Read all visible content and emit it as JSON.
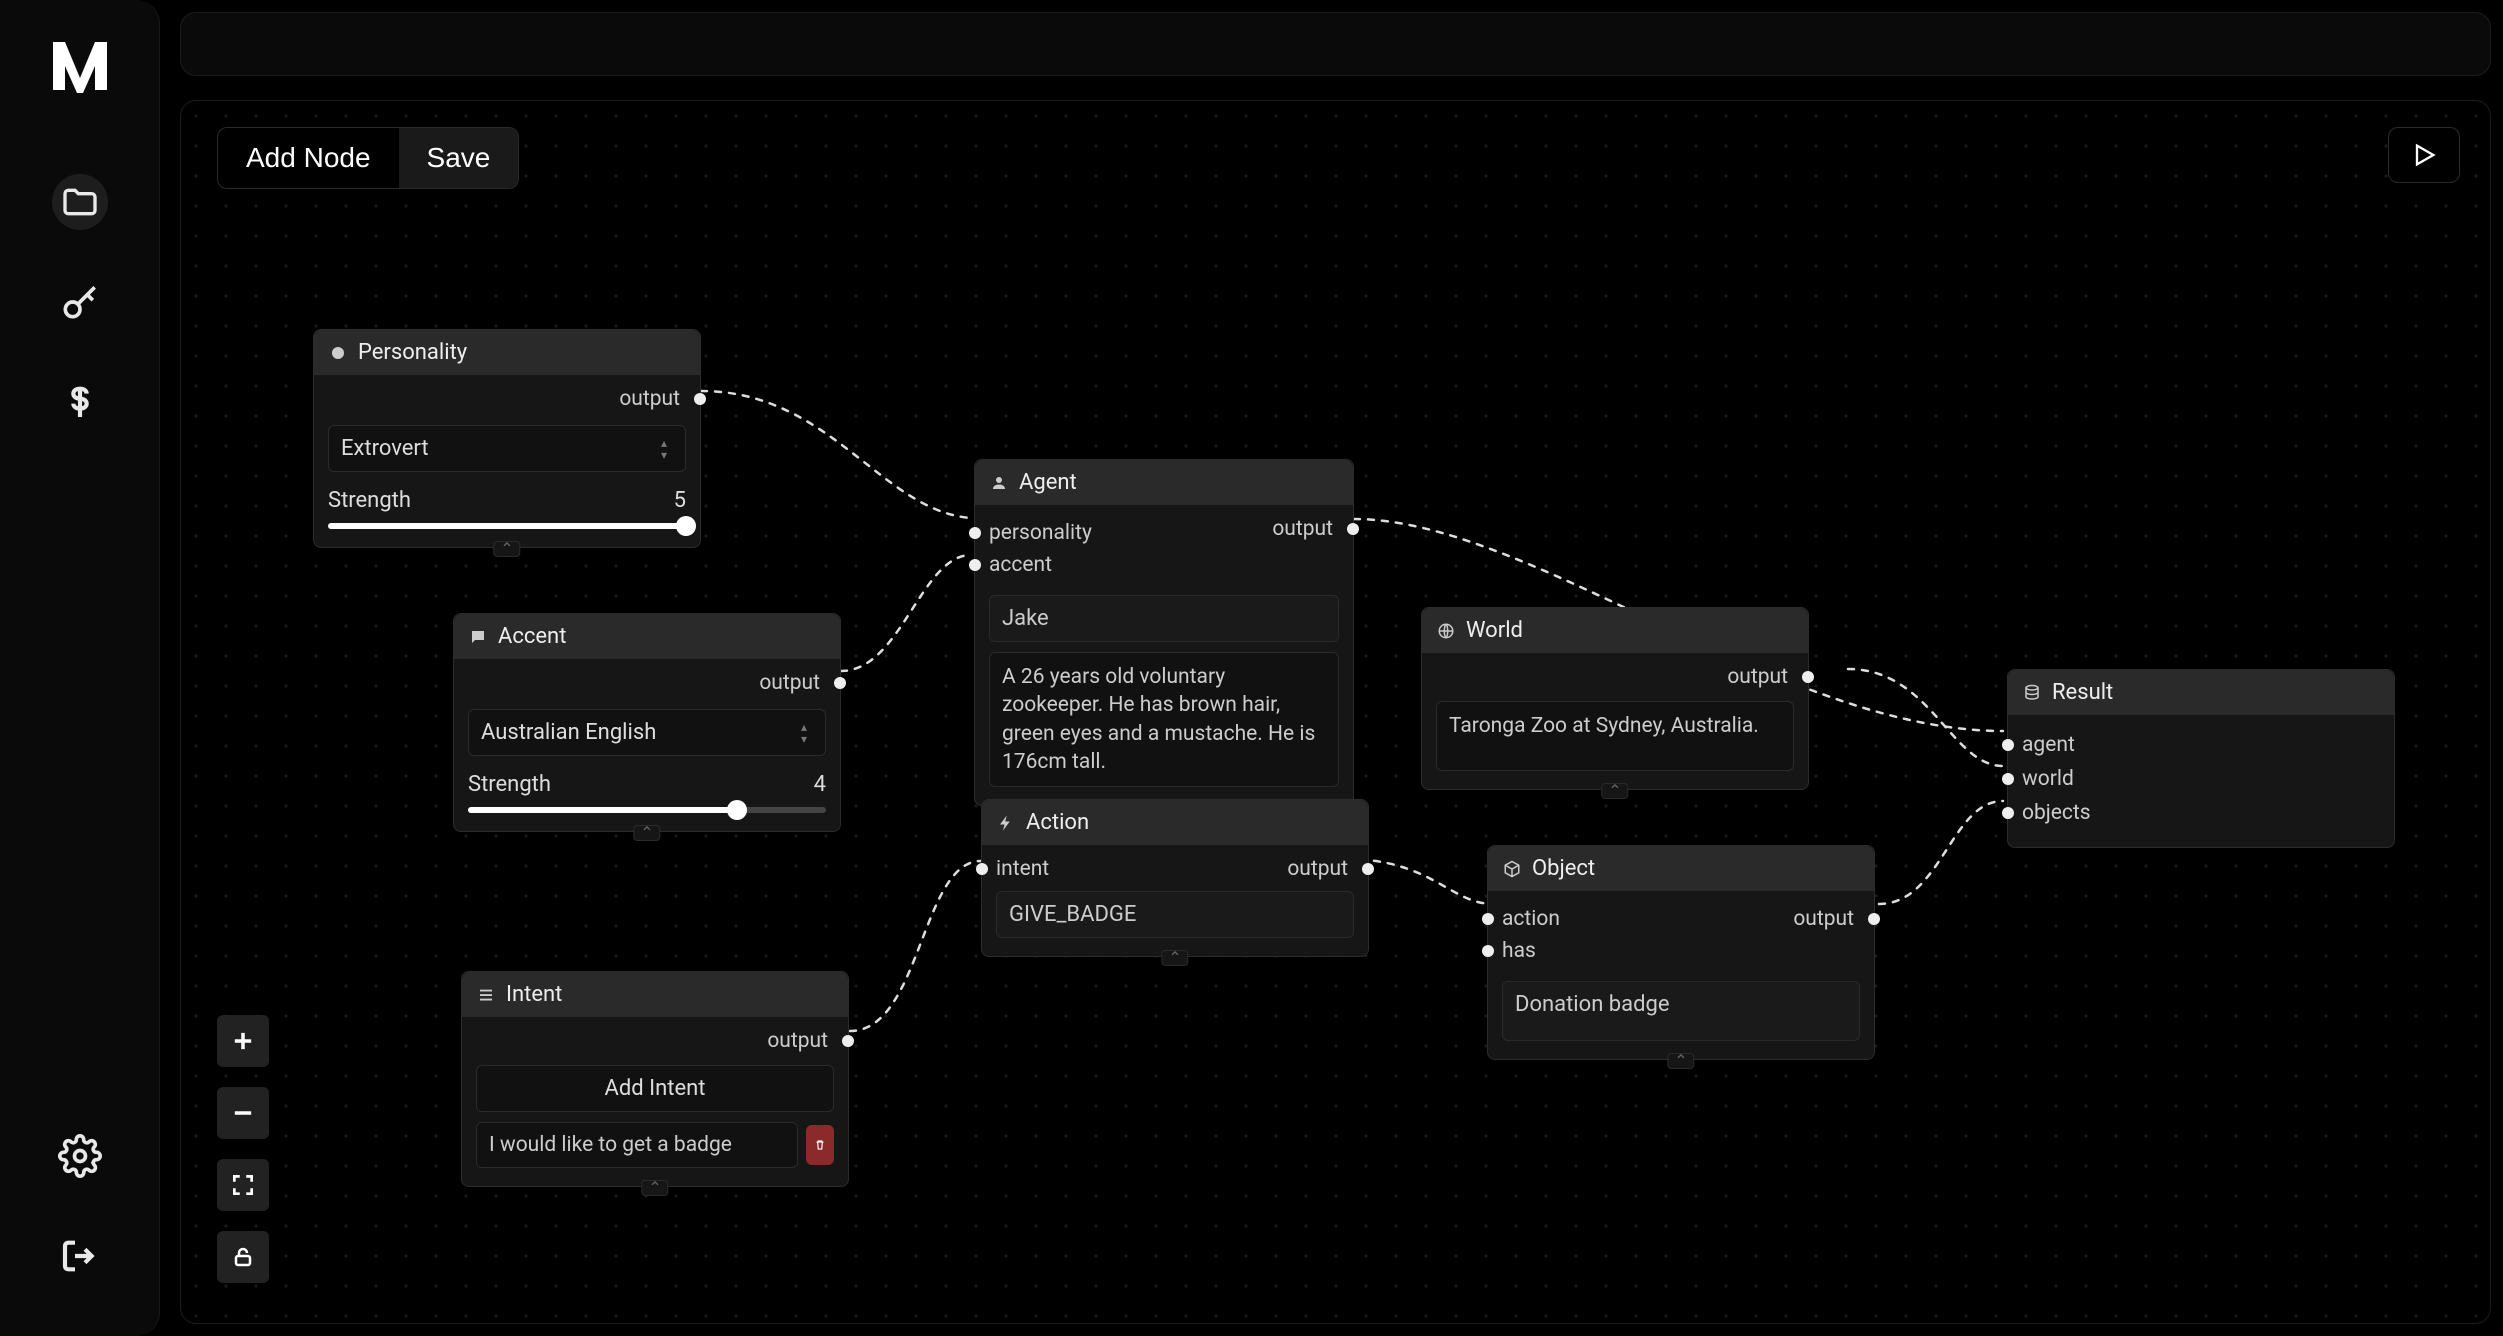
{
  "toolbar": {
    "add_node_label": "Add Node",
    "save_label": "Save"
  },
  "nodes": {
    "personality": {
      "title": "Personality",
      "output_label": "output",
      "select_value": "Extrovert",
      "strength_label": "Strength",
      "strength_value": "5",
      "strength_pct": 100
    },
    "accent": {
      "title": "Accent",
      "output_label": "output",
      "select_value": "Australian English",
      "strength_label": "Strength",
      "strength_value": "4",
      "strength_pct": 75
    },
    "intent": {
      "title": "Intent",
      "output_label": "output",
      "add_button": "Add Intent",
      "items": [
        {
          "text": "I would like to get a badge"
        }
      ]
    },
    "agent": {
      "title": "Agent",
      "inputs": {
        "personality": "personality",
        "accent": "accent"
      },
      "output_label": "output",
      "name_value": "Jake",
      "description_value": "A 26 years old voluntary zookeeper. He has brown hair, green eyes and a mustache. He is 176cm tall."
    },
    "action": {
      "title": "Action",
      "inputs": {
        "intent": "intent"
      },
      "output_label": "output",
      "value": "GIVE_BADGE"
    },
    "world": {
      "title": "World",
      "output_label": "output",
      "description_value": "Taronga Zoo at Sydney, Australia."
    },
    "object": {
      "title": "Object",
      "inputs": {
        "action": "action",
        "has": "has"
      },
      "output_label": "output",
      "value": "Donation badge"
    },
    "result": {
      "title": "Result",
      "inputs": {
        "agent": "agent",
        "world": "world",
        "objects": "objects"
      }
    }
  }
}
